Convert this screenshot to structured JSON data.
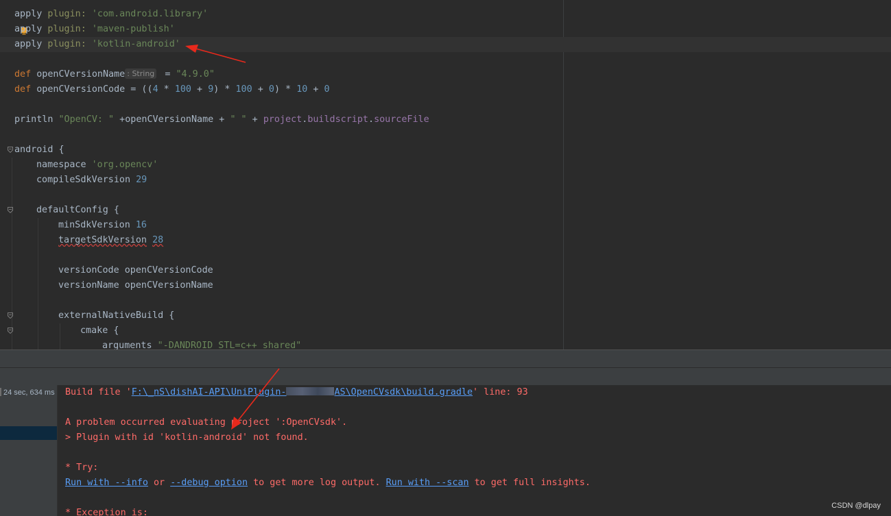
{
  "editor": {
    "lines": {
      "l1": {
        "apply": "apply",
        "plugin": "plugin:",
        "val": "'com.android.library'"
      },
      "l2": {
        "apply": "apply",
        "plugin": "plugin:",
        "val": "'maven-publish'"
      },
      "l3": {
        "apply": "apply",
        "plugin": "plugin:",
        "val": "'kotlin-android'"
      },
      "l5": {
        "def": "def",
        "name": "openCVersionName",
        "hint": ": String",
        "eq": " = ",
        "val": "\"4.9.0\""
      },
      "l6": {
        "def": "def",
        "name": "openCVersionCode",
        "eq": " = ((",
        "n4": "4",
        "op1": " * ",
        "n100a": "100",
        "op2": " + ",
        "n9": "9",
        "op3": ") * ",
        "n100b": "100",
        "op4": " + ",
        "n0": "0",
        "op5": ") * ",
        "n10": "10",
        "op6": " + ",
        "n0b": "0"
      },
      "l8": {
        "fn": "println",
        "s1": "\"OpenCV: \"",
        "mid": " +openCVersionName + ",
        "s2": "\" \"",
        "plus": " + ",
        "p1": "project",
        "dot1": ".",
        "p2": "buildscript",
        "dot2": ".",
        "p3": "sourceFile"
      },
      "l10": {
        "text": "android {"
      },
      "l11": {
        "key": "namespace",
        "val": "'org.opencv'"
      },
      "l12": {
        "key": "compileSdkVersion",
        "val": "29"
      },
      "l14": {
        "text": "defaultConfig {"
      },
      "l15": {
        "key": "minSdkVersion",
        "val": "16"
      },
      "l16": {
        "key": "targetSdkVersion",
        "val": "28"
      },
      "l18": {
        "text": "versionCode openCVersionCode"
      },
      "l19": {
        "text": "versionName openCVersionName"
      },
      "l21": {
        "text": "externalNativeBuild {"
      },
      "l22": {
        "text": "cmake {"
      },
      "l23": {
        "key": "arguments",
        "val": "\"-DANDROID_STL=c++_shared\""
      }
    }
  },
  "build_tree": {
    "time": "24 sec, 634 ms"
  },
  "console": {
    "c1": {
      "pre": "Build file '",
      "path_a": "F:\\_nS\\dishAI-API\\UniPlugin-",
      "path_b": "AS\\OpenCVsdk\\build.gradle",
      "post": "' line: 93"
    },
    "c3": "A problem occurred evaluating project ':OpenCVsdk'.",
    "c4": "> Plugin with id 'kotlin-android' not found.",
    "c6": "* Try:",
    "c7": {
      "link1": "Run with --info",
      "t1": " or ",
      "link2": "--debug option",
      "t2": " to get more log output. ",
      "link3": "Run with --scan",
      "t3": " to get full insights."
    },
    "c9": "* Exception is:"
  },
  "watermark": "CSDN @dlpay",
  "colors": {
    "arrow": "#e8291c",
    "error": "#ff6b68",
    "link": "#589df6",
    "keyword": "#cc7832",
    "string": "#6a8759",
    "number": "#6897bb"
  },
  "icons": [
    "fold-icon",
    "intention-bulb-icon"
  ]
}
